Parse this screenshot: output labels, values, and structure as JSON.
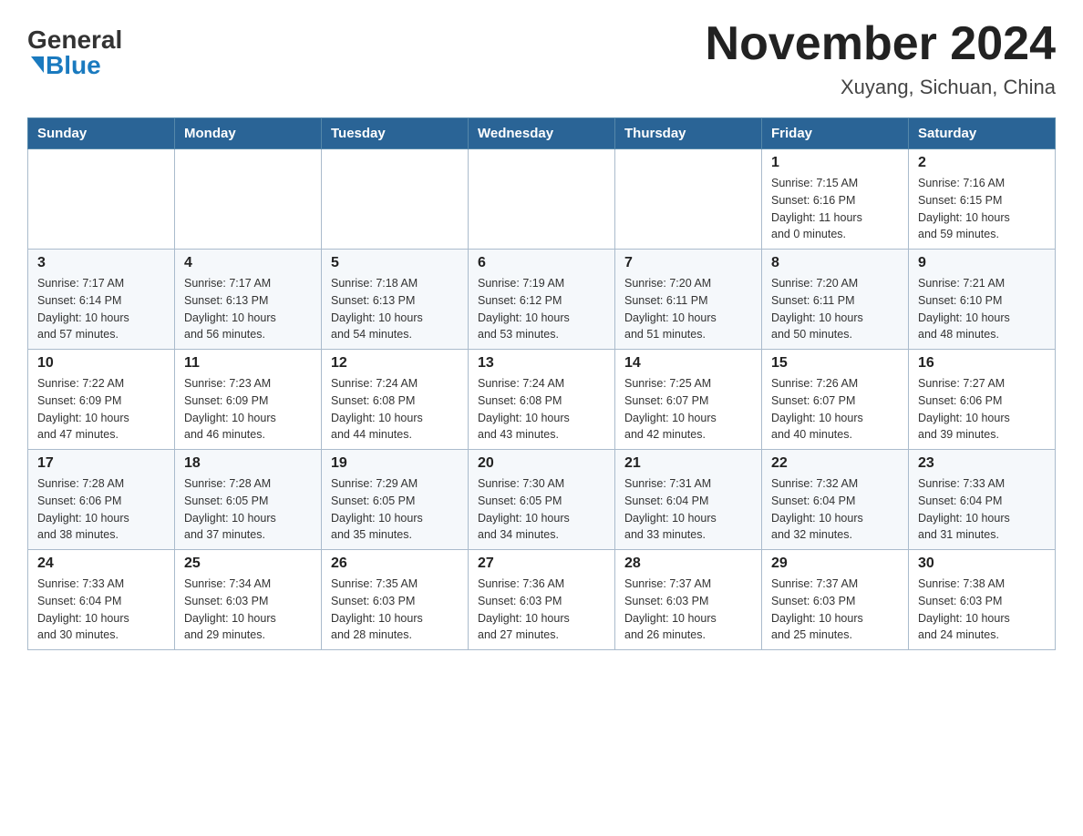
{
  "logo": {
    "general": "General",
    "blue": "Blue"
  },
  "header": {
    "month": "November 2024",
    "location": "Xuyang, Sichuan, China"
  },
  "days_of_week": [
    "Sunday",
    "Monday",
    "Tuesday",
    "Wednesday",
    "Thursday",
    "Friday",
    "Saturday"
  ],
  "weeks": [
    [
      {
        "day": "",
        "info": ""
      },
      {
        "day": "",
        "info": ""
      },
      {
        "day": "",
        "info": ""
      },
      {
        "day": "",
        "info": ""
      },
      {
        "day": "",
        "info": ""
      },
      {
        "day": "1",
        "info": "Sunrise: 7:15 AM\nSunset: 6:16 PM\nDaylight: 11 hours\nand 0 minutes."
      },
      {
        "day": "2",
        "info": "Sunrise: 7:16 AM\nSunset: 6:15 PM\nDaylight: 10 hours\nand 59 minutes."
      }
    ],
    [
      {
        "day": "3",
        "info": "Sunrise: 7:17 AM\nSunset: 6:14 PM\nDaylight: 10 hours\nand 57 minutes."
      },
      {
        "day": "4",
        "info": "Sunrise: 7:17 AM\nSunset: 6:13 PM\nDaylight: 10 hours\nand 56 minutes."
      },
      {
        "day": "5",
        "info": "Sunrise: 7:18 AM\nSunset: 6:13 PM\nDaylight: 10 hours\nand 54 minutes."
      },
      {
        "day": "6",
        "info": "Sunrise: 7:19 AM\nSunset: 6:12 PM\nDaylight: 10 hours\nand 53 minutes."
      },
      {
        "day": "7",
        "info": "Sunrise: 7:20 AM\nSunset: 6:11 PM\nDaylight: 10 hours\nand 51 minutes."
      },
      {
        "day": "8",
        "info": "Sunrise: 7:20 AM\nSunset: 6:11 PM\nDaylight: 10 hours\nand 50 minutes."
      },
      {
        "day": "9",
        "info": "Sunrise: 7:21 AM\nSunset: 6:10 PM\nDaylight: 10 hours\nand 48 minutes."
      }
    ],
    [
      {
        "day": "10",
        "info": "Sunrise: 7:22 AM\nSunset: 6:09 PM\nDaylight: 10 hours\nand 47 minutes."
      },
      {
        "day": "11",
        "info": "Sunrise: 7:23 AM\nSunset: 6:09 PM\nDaylight: 10 hours\nand 46 minutes."
      },
      {
        "day": "12",
        "info": "Sunrise: 7:24 AM\nSunset: 6:08 PM\nDaylight: 10 hours\nand 44 minutes."
      },
      {
        "day": "13",
        "info": "Sunrise: 7:24 AM\nSunset: 6:08 PM\nDaylight: 10 hours\nand 43 minutes."
      },
      {
        "day": "14",
        "info": "Sunrise: 7:25 AM\nSunset: 6:07 PM\nDaylight: 10 hours\nand 42 minutes."
      },
      {
        "day": "15",
        "info": "Sunrise: 7:26 AM\nSunset: 6:07 PM\nDaylight: 10 hours\nand 40 minutes."
      },
      {
        "day": "16",
        "info": "Sunrise: 7:27 AM\nSunset: 6:06 PM\nDaylight: 10 hours\nand 39 minutes."
      }
    ],
    [
      {
        "day": "17",
        "info": "Sunrise: 7:28 AM\nSunset: 6:06 PM\nDaylight: 10 hours\nand 38 minutes."
      },
      {
        "day": "18",
        "info": "Sunrise: 7:28 AM\nSunset: 6:05 PM\nDaylight: 10 hours\nand 37 minutes."
      },
      {
        "day": "19",
        "info": "Sunrise: 7:29 AM\nSunset: 6:05 PM\nDaylight: 10 hours\nand 35 minutes."
      },
      {
        "day": "20",
        "info": "Sunrise: 7:30 AM\nSunset: 6:05 PM\nDaylight: 10 hours\nand 34 minutes."
      },
      {
        "day": "21",
        "info": "Sunrise: 7:31 AM\nSunset: 6:04 PM\nDaylight: 10 hours\nand 33 minutes."
      },
      {
        "day": "22",
        "info": "Sunrise: 7:32 AM\nSunset: 6:04 PM\nDaylight: 10 hours\nand 32 minutes."
      },
      {
        "day": "23",
        "info": "Sunrise: 7:33 AM\nSunset: 6:04 PM\nDaylight: 10 hours\nand 31 minutes."
      }
    ],
    [
      {
        "day": "24",
        "info": "Sunrise: 7:33 AM\nSunset: 6:04 PM\nDaylight: 10 hours\nand 30 minutes."
      },
      {
        "day": "25",
        "info": "Sunrise: 7:34 AM\nSunset: 6:03 PM\nDaylight: 10 hours\nand 29 minutes."
      },
      {
        "day": "26",
        "info": "Sunrise: 7:35 AM\nSunset: 6:03 PM\nDaylight: 10 hours\nand 28 minutes."
      },
      {
        "day": "27",
        "info": "Sunrise: 7:36 AM\nSunset: 6:03 PM\nDaylight: 10 hours\nand 27 minutes."
      },
      {
        "day": "28",
        "info": "Sunrise: 7:37 AM\nSunset: 6:03 PM\nDaylight: 10 hours\nand 26 minutes."
      },
      {
        "day": "29",
        "info": "Sunrise: 7:37 AM\nSunset: 6:03 PM\nDaylight: 10 hours\nand 25 minutes."
      },
      {
        "day": "30",
        "info": "Sunrise: 7:38 AM\nSunset: 6:03 PM\nDaylight: 10 hours\nand 24 minutes."
      }
    ]
  ]
}
